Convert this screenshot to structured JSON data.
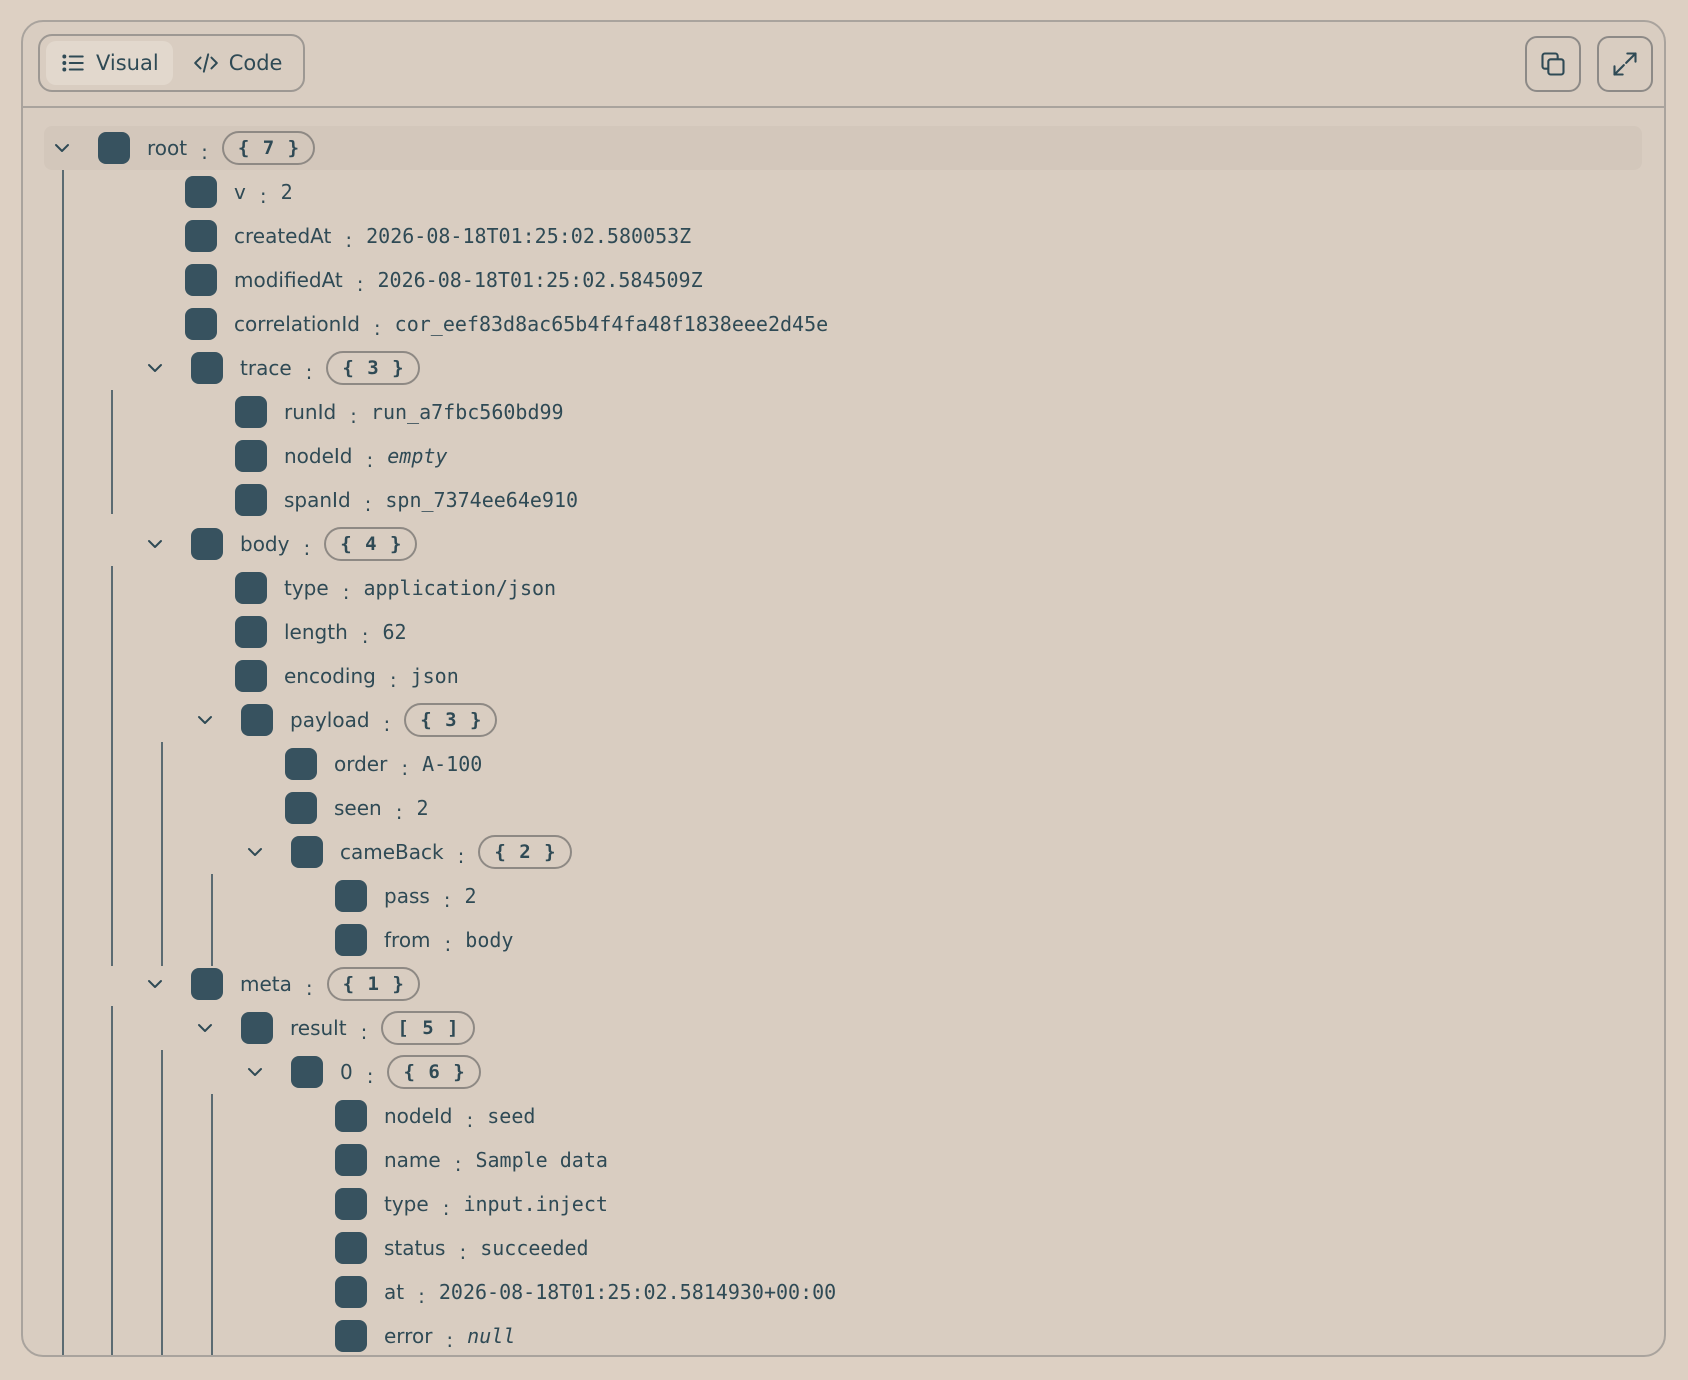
{
  "toolbar": {
    "tabs": [
      {
        "label": "Visual",
        "active": true
      },
      {
        "label": "Code",
        "active": false
      }
    ],
    "copy_icon": "copy-icon",
    "expand_icon": "expand-icon"
  },
  "tree": {
    "root": {
      "key": "root",
      "badge": "{ 7 }"
    },
    "v": {
      "key": "v",
      "value": "2"
    },
    "createdAt": {
      "key": "createdAt",
      "value": "2026-08-18T01:25:02.580053Z"
    },
    "modifiedAt": {
      "key": "modifiedAt",
      "value": "2026-08-18T01:25:02.584509Z"
    },
    "correlationId": {
      "key": "correlationId",
      "value": "cor_eef83d8ac65b4f4fa48f1838eee2d45e"
    },
    "trace": {
      "key": "trace",
      "badge": "{ 3 }"
    },
    "runId": {
      "key": "runId",
      "value": "run_a7fbc560bd99"
    },
    "trace_nodeId": {
      "key": "nodeId",
      "value": "empty"
    },
    "spanId": {
      "key": "spanId",
      "value": "spn_7374ee64e910"
    },
    "body": {
      "key": "body",
      "badge": "{ 4 }"
    },
    "body_type": {
      "key": "type",
      "value": "application/json"
    },
    "length": {
      "key": "length",
      "value": "62"
    },
    "encoding": {
      "key": "encoding",
      "value": "json"
    },
    "payload": {
      "key": "payload",
      "badge": "{ 3 }"
    },
    "order": {
      "key": "order",
      "value": "A-100"
    },
    "seen": {
      "key": "seen",
      "value": "2"
    },
    "cameBack": {
      "key": "cameBack",
      "badge": "{ 2 }"
    },
    "pass": {
      "key": "pass",
      "value": "2"
    },
    "from": {
      "key": "from",
      "value": "body"
    },
    "meta": {
      "key": "meta",
      "badge": "{ 1 }"
    },
    "result": {
      "key": "result",
      "badge": "[ 5 ]"
    },
    "item0": {
      "key": "0",
      "badge": "{ 6 }"
    },
    "r_nodeId": {
      "key": "nodeId",
      "value": "seed"
    },
    "r_name": {
      "key": "name",
      "value": "Sample data"
    },
    "r_type": {
      "key": "type",
      "value": "input.inject"
    },
    "r_status": {
      "key": "status",
      "value": "succeeded"
    },
    "r_at": {
      "key": "at",
      "value": "2026-08-18T01:25:02.5814930+00:00"
    },
    "r_error": {
      "key": "error",
      "value": "null"
    }
  },
  "colors": {
    "background": "#ddd0c3",
    "panel": "#d9cdc1",
    "accent": "#37525f",
    "text": "#2f4a55"
  }
}
